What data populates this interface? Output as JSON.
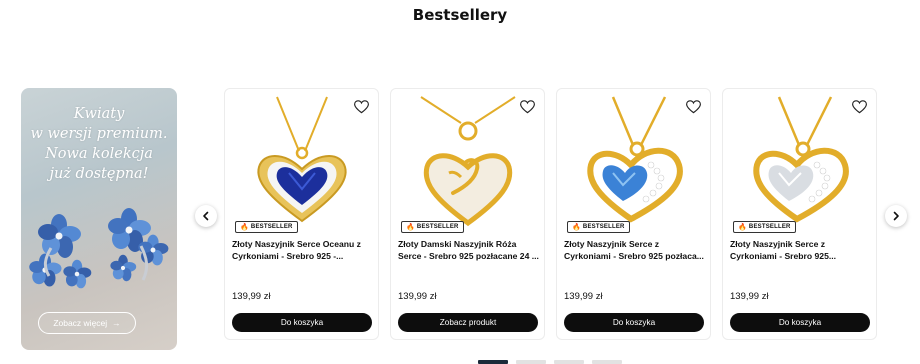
{
  "section": {
    "title": "Bestsellery"
  },
  "promo": {
    "lines": [
      "Kwiaty",
      "w wersji premium.",
      "Nowa kolekcja",
      "już dostępna!"
    ],
    "button_label": "Zobacz więcej",
    "button_arrow": "→"
  },
  "carousel": {
    "prev_icon": "‹",
    "next_icon": "›"
  },
  "products": [
    {
      "badge": "BESTSELLER",
      "name": "Złoty Naszyjnik Serce Oceanu z Cyrkoniami - Srebro 925 -...",
      "price": "139,99 zł",
      "cta": "Do koszyka",
      "stone": "#1c2f9c",
      "stone_light": "#3c5ad6",
      "show_badge": true
    },
    {
      "badge": "BESTSELLER",
      "name": "Złoty Damski Naszyjnik Róża Serce - Srebro 925 pozłacane 24 ...",
      "price": "139,99 zł",
      "cta": "Zobacz produkt",
      "stone": "#f3ede0",
      "stone_light": "#ffffff",
      "show_badge": true
    },
    {
      "badge": "BESTSELLER",
      "name": "Złoty Naszyjnik Serce z Cyrkoniami - Srebro 925 pozłaca...",
      "price": "139,99 zł",
      "cta": "Do koszyka",
      "stone": "#3b82d6",
      "stone_light": "#8ec3f2",
      "show_badge": true
    },
    {
      "badge": "BESTSELLER",
      "name": "Złoty Naszyjnik Serce z Cyrkoniami - Srebro 925...",
      "price": "139,99 zł",
      "cta": "Do koszyka",
      "stone": "#d9dde2",
      "stone_light": "#ffffff",
      "show_badge": true
    }
  ],
  "pagination": {
    "count": 4,
    "active": 0
  },
  "colors": {
    "gold": "#e2ad2a",
    "gold_dark": "#b8831a",
    "button": "#0d0d0d",
    "dot_active": "#1b2a3a"
  }
}
